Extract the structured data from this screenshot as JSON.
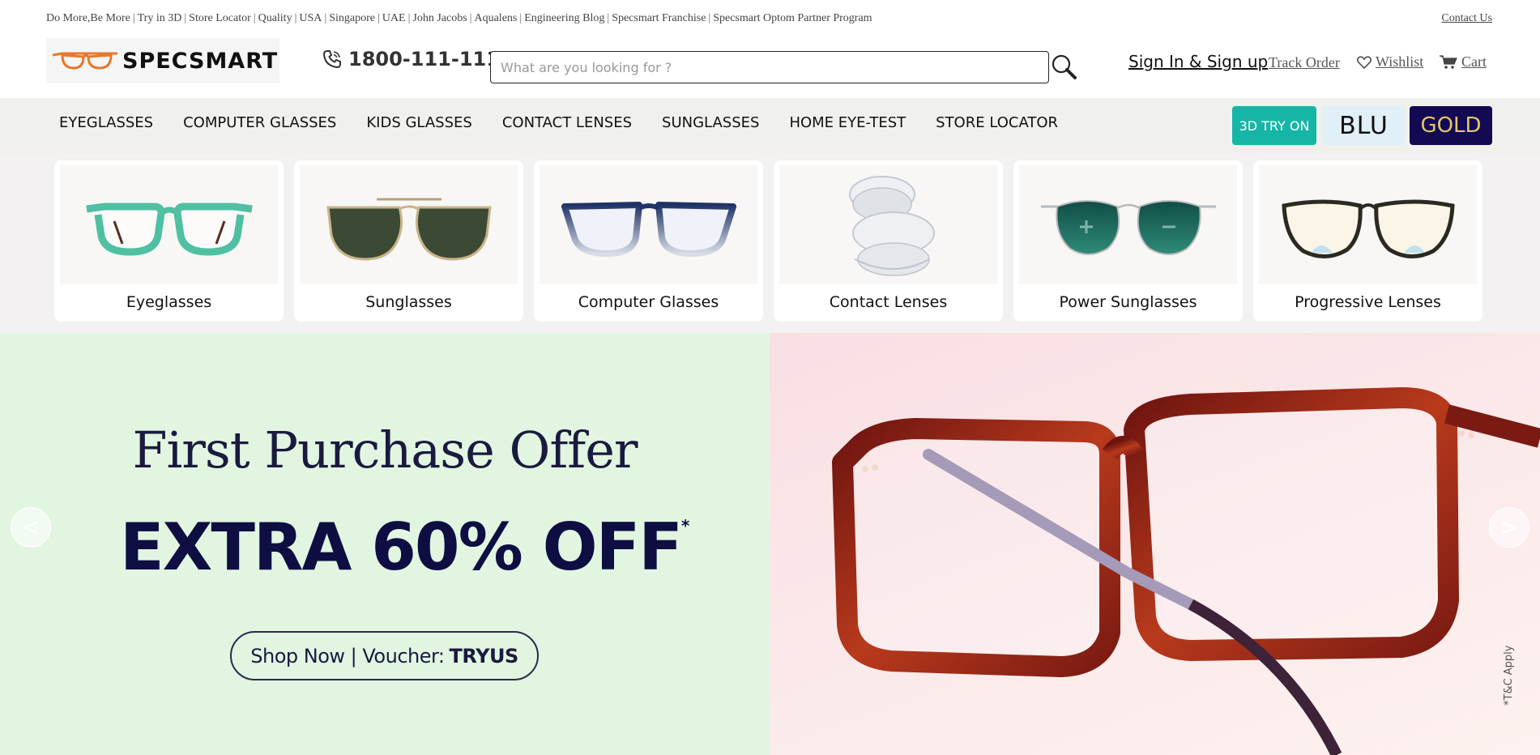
{
  "topbar": {
    "links": [
      "Do More,Be More",
      "Try in 3D",
      "Store Locator",
      "Quality",
      "USA",
      "Singapore",
      "UAE",
      "John Jacobs",
      "Aqualens",
      "Engineering Blog",
      "Specsmart Franchise",
      "Specsmart Optom Partner Program"
    ],
    "contact": "Contact Us"
  },
  "header": {
    "logo_text": "SPECSMART",
    "phone": "1800-111-111",
    "search_placeholder": "What are you looking for ?",
    "signin": "Sign In & Sign up",
    "track": "Track Order",
    "wishlist": "Wishlist",
    "cart": "Cart"
  },
  "nav": {
    "items": [
      "EYEGLASSES",
      "COMPUTER GLASSES",
      "KIDS GLASSES",
      "CONTACT LENSES",
      "SUNGLASSES",
      "HOME EYE-TEST",
      "STORE LOCATOR"
    ],
    "try_on": "3D TRY ON",
    "blu": "BLU",
    "gold": "GOLD"
  },
  "categories": [
    {
      "label": "Eyeglasses"
    },
    {
      "label": "Sunglasses"
    },
    {
      "label": "Computer Glasses"
    },
    {
      "label": "Contact Lenses"
    },
    {
      "label": "Power Sunglasses"
    },
    {
      "label": "Progressive Lenses"
    }
  ],
  "banner": {
    "title": "First Purchase Offer",
    "offer": "EXTRA 60% OFF",
    "offer_mark": "*",
    "cta_prefix": "Shop Now | Voucher:",
    "cta_code": "TRYUS",
    "prev": "<",
    "next": ">",
    "tc": "*T&C Apply"
  },
  "colors": {
    "try_on_bg": "#16b6a6",
    "blu_bg": "#e1eff7",
    "gold_bg": "#120a52",
    "banner_left_bg": "#e1f5e1",
    "offer_text": "#0e0e42"
  }
}
